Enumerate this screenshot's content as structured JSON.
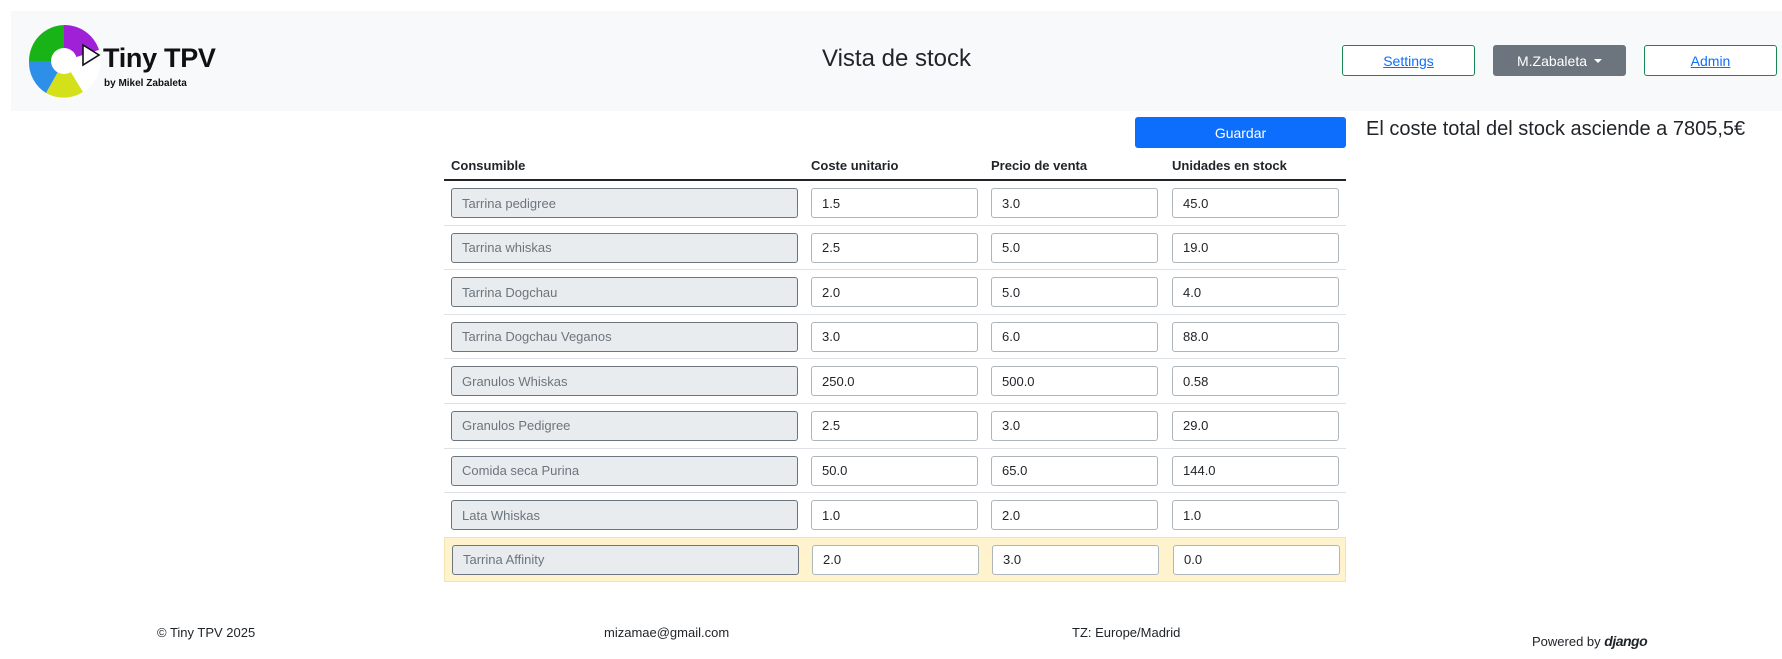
{
  "header": {
    "brand_name": "Tiny TPV",
    "brand_sub": "by Mikel Zabaleta",
    "page_title": "Vista de stock",
    "settings_label": "Settings",
    "user_label": "M.Zabaleta",
    "admin_label": "Admin"
  },
  "actions": {
    "save_label": "Guardar",
    "total_text": "El coste total del stock asciende a 7805,5€"
  },
  "table": {
    "headers": [
      "Consumible",
      "Coste unitario",
      "Precio de venta",
      "Unidades en stock"
    ],
    "rows": [
      {
        "name": "Tarrina pedigree",
        "cost": "1.5",
        "price": "3.0",
        "units": "45.0"
      },
      {
        "name": "Tarrina whiskas",
        "cost": "2.5",
        "price": "5.0",
        "units": "19.0"
      },
      {
        "name": "Tarrina Dogchau",
        "cost": "2.0",
        "price": "5.0",
        "units": "4.0"
      },
      {
        "name": "Tarrina Dogchau Veganos",
        "cost": "3.0",
        "price": "6.0",
        "units": "88.0"
      },
      {
        "name": "Granulos Whiskas",
        "cost": "250.0",
        "price": "500.0",
        "units": "0.58"
      },
      {
        "name": "Granulos Pedigree",
        "cost": "2.5",
        "price": "3.0",
        "units": "29.0"
      },
      {
        "name": "Comida seca Purina",
        "cost": "50.0",
        "price": "65.0",
        "units": "144.0"
      },
      {
        "name": "Lata Whiskas",
        "cost": "1.0",
        "price": "2.0",
        "units": "1.0"
      },
      {
        "name": "Tarrina Affinity",
        "cost": "2.0",
        "price": "3.0",
        "units": "0.0"
      }
    ]
  },
  "footer": {
    "copyright": "© Tiny TPV 2025",
    "email": "mizamae@gmail.com",
    "timezone": "TZ: Europe/Madrid",
    "powered_by": "Powered by",
    "django": "django"
  },
  "colors": {
    "primary": "#0d6efd",
    "outline_green": "#198754",
    "grey_button": "#6c757d",
    "warning_row": "#fff3cd",
    "navbar_bg": "#f8f9fa"
  }
}
